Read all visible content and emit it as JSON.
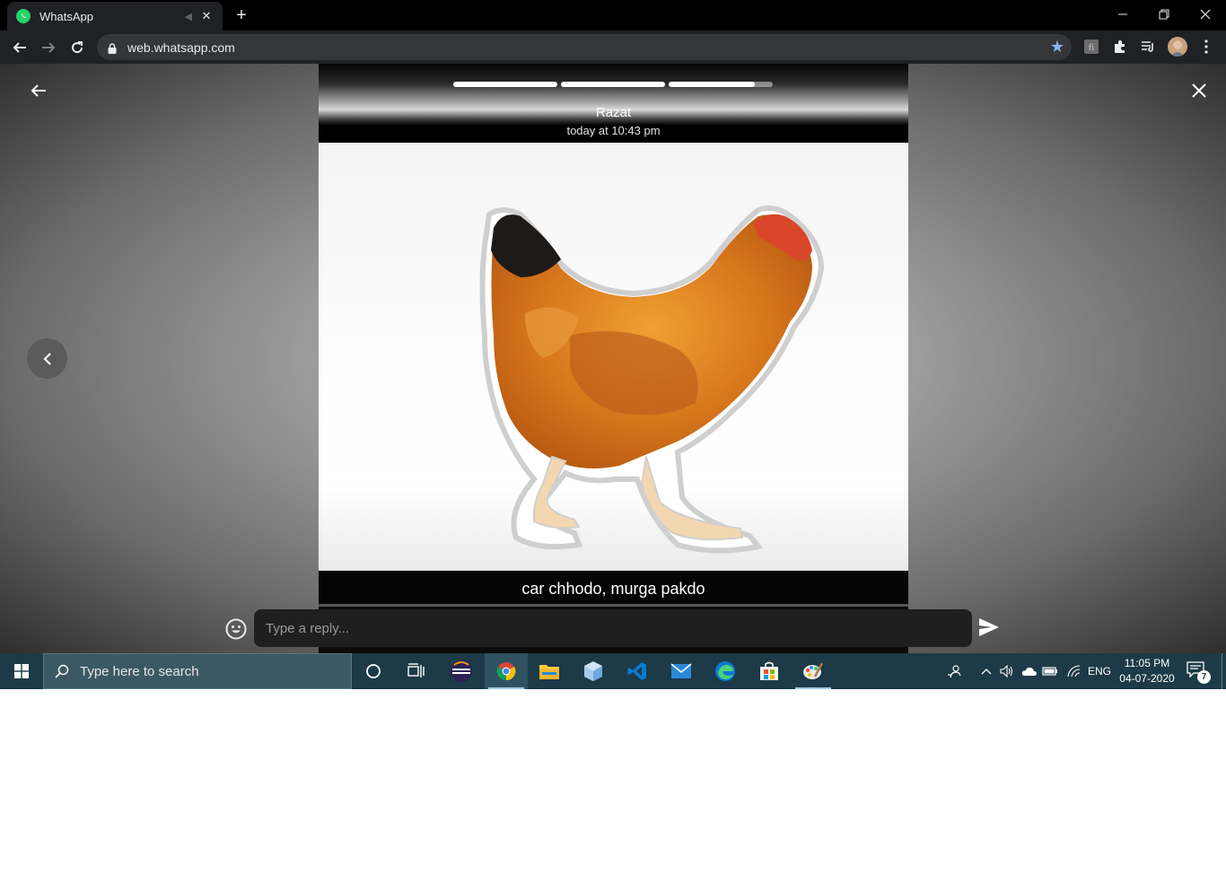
{
  "browser": {
    "tab": {
      "title": "WhatsApp",
      "favicon": "whatsapp-icon",
      "close": "✕",
      "audio": "mute-icon"
    },
    "new_tab": "+",
    "window_controls": {
      "minimize": "—",
      "restore": "❐",
      "close": "✕"
    },
    "url": "web.whatsapp.com",
    "bookmark_star": "★"
  },
  "status_viewer": {
    "contact_name": "Razat",
    "time": "today at 10:43 pm",
    "progress_segments": [
      1.0,
      1.0,
      0.83
    ],
    "caption": "car chhodo, murga pakdo",
    "reply_placeholder": "Type a reply..."
  },
  "taskbar": {
    "search_placeholder": "Type here to search",
    "apps": [
      "cortana-icon",
      "task-view-icon",
      "eclipse-icon",
      "chrome-icon",
      "file-explorer-icon",
      "3d-viewer-icon",
      "vscode-icon",
      "mail-icon",
      "edge-icon",
      "store-icon",
      "paint-icon"
    ],
    "language": "ENG",
    "time": "11:05 PM",
    "date": "04-07-2020",
    "notification_count": "7"
  },
  "colors": {
    "tabbar": "#000000",
    "toolbar": "#202124",
    "taskbar": "#1c3a47",
    "whatsapp_green": "#25d366",
    "star_blue": "#8ab4f8"
  }
}
